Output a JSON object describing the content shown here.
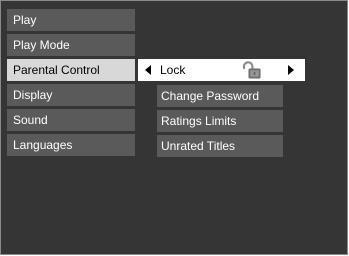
{
  "left_menu": {
    "items": [
      {
        "label": "Play"
      },
      {
        "label": "Play Mode"
      },
      {
        "label": "Parental Control",
        "selected": true
      },
      {
        "label": "Display"
      },
      {
        "label": "Sound"
      },
      {
        "label": "Languages"
      }
    ]
  },
  "parental_control": {
    "option_value": "Lock",
    "status_icon": "unlocked-padlock-icon",
    "submenu": [
      {
        "label": "Change Password"
      },
      {
        "label": "Ratings Limits"
      },
      {
        "label": "Unrated Titles"
      }
    ]
  },
  "colors": {
    "panel_background": "#353535",
    "menu_item_background": "#5a5a5a",
    "selected_item_background": "#d8d8d8",
    "selector_background": "#ffffff"
  }
}
